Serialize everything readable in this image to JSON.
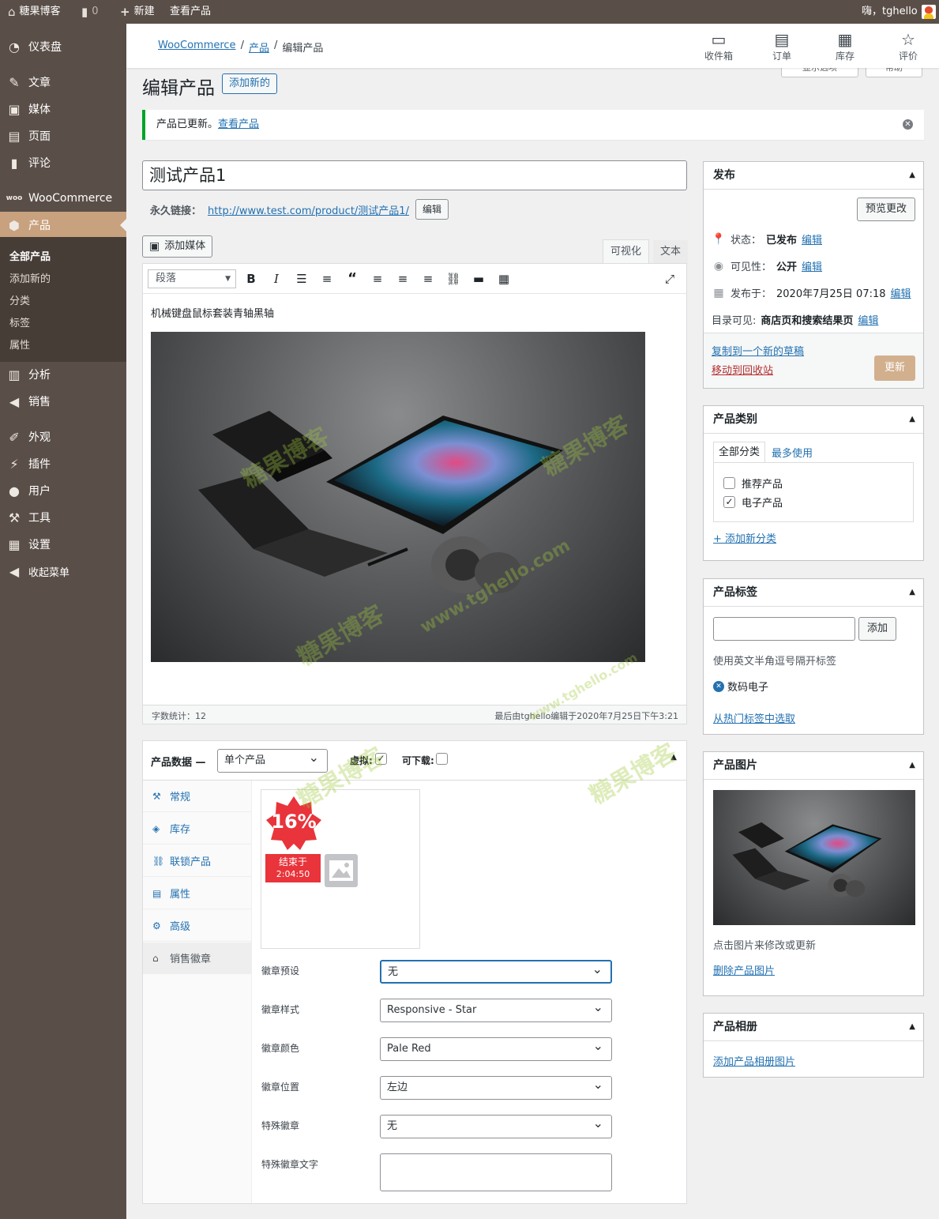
{
  "adminbar": {
    "site_name": "糖果博客",
    "comments_count": "0",
    "new_label": "新建",
    "view_product": "查看产品",
    "greeting": "嗨，tghello"
  },
  "sidebar": {
    "items": [
      {
        "label": "仪表盘",
        "icon": "dashboard-icon"
      },
      {
        "label": "文章",
        "icon": "pin-icon"
      },
      {
        "label": "媒体",
        "icon": "media-icon"
      },
      {
        "label": "页面",
        "icon": "page-icon"
      },
      {
        "label": "评论",
        "icon": "comment-icon"
      },
      {
        "label": "WooCommerce",
        "icon": "woocommerce-icon"
      },
      {
        "label": "产品",
        "icon": "product-icon"
      },
      {
        "label": "分析",
        "icon": "chart-icon"
      },
      {
        "label": "销售",
        "icon": "megaphone-icon"
      },
      {
        "label": "外观",
        "icon": "brush-icon"
      },
      {
        "label": "插件",
        "icon": "plugin-icon"
      },
      {
        "label": "用户",
        "icon": "user-icon"
      },
      {
        "label": "工具",
        "icon": "wrench-icon"
      },
      {
        "label": "设置",
        "icon": "settings-icon"
      },
      {
        "label": "收起菜单",
        "icon": "collapse-icon"
      }
    ],
    "submenu": [
      "全部产品",
      "添加新的",
      "分类",
      "标签",
      "属性"
    ]
  },
  "header": {
    "breadcrumb": [
      "WooCommerce",
      "产品",
      "编辑产品"
    ],
    "buttons": [
      {
        "label": "收件箱",
        "icon": "inbox-icon"
      },
      {
        "label": "订单",
        "icon": "orders-icon"
      },
      {
        "label": "库存",
        "icon": "stock-icon"
      },
      {
        "label": "评价",
        "icon": "star-icon"
      }
    ],
    "screen_options": "显示选项",
    "help": "帮助"
  },
  "page": {
    "title": "编辑产品",
    "add_new": "添加新的",
    "notice_text": "产品已更新。",
    "notice_link": "查看产品"
  },
  "editor": {
    "product_title": "测试产品1",
    "permalink_label": "永久链接：",
    "permalink_url": "http://www.test.com/product/测试产品1/",
    "permalink_edit": "编辑",
    "add_media": "添加媒体",
    "tab_visual": "可视化",
    "tab_text": "文本",
    "format": "段落",
    "content": "机械键盘鼠标套装青轴黑轴",
    "word_count": "字数统计：12",
    "last_edited": "最后由tghello编辑于2020年7月25日下午3:21"
  },
  "product_data": {
    "label": "产品数据 —",
    "type": "单个产品",
    "virtual_label": "虚拟:",
    "downloadable_label": "可下载:",
    "tabs": [
      "常规",
      "库存",
      "联锁产品",
      "属性",
      "高级",
      "销售徽章"
    ],
    "badge_percent": "16%",
    "badge_ends": "结束于",
    "badge_time": "2:04:50",
    "fields": [
      {
        "label": "徽章预设",
        "value": "无"
      },
      {
        "label": "徽章样式",
        "value": "Responsive - Star"
      },
      {
        "label": "徽章颜色",
        "value": "Pale Red"
      },
      {
        "label": "徽章位置",
        "value": "左边"
      },
      {
        "label": "特殊徽章",
        "value": "无"
      },
      {
        "label": "特殊徽章文字",
        "value": ""
      }
    ]
  },
  "publish": {
    "title": "发布",
    "preview": "预览更改",
    "status_label": "状态：",
    "status_value": "已发布",
    "visibility_label": "可见性：",
    "visibility_value": "公开",
    "published_label": "发布于：",
    "published_value": "2020年7月25日 07:18",
    "catalog_label": "目录可见:",
    "catalog_value": "商店页和搜索结果页",
    "edit": "编辑",
    "duplicate": "复制到一个新的草稿",
    "trash": "移动到回收站",
    "update": "更新"
  },
  "categories": {
    "title": "产品类别",
    "tab_all": "全部分类",
    "tab_popular": "最多使用",
    "items": [
      {
        "label": "推荐产品",
        "checked": false
      },
      {
        "label": "电子产品",
        "checked": true
      }
    ],
    "add_new": "+ 添加新分类"
  },
  "tags": {
    "title": "产品标签",
    "add": "添加",
    "hint": "使用英文半角逗号隔开标签",
    "tag": "数码电子",
    "choose": "从热门标签中选取"
  },
  "product_image": {
    "title": "产品图片",
    "hint": "点击图片来修改或更新",
    "remove": "删除产品图片"
  },
  "gallery": {
    "title": "产品相册",
    "add": "添加产品相册图片"
  },
  "watermarks": [
    "糖果博客",
    "www.tghello.com",
    "tghello.com"
  ],
  "colors": {
    "sidebar": "#5a4f48",
    "accent": "#c8a27e",
    "link": "#2271b1",
    "badge_red": "#e8343a"
  }
}
